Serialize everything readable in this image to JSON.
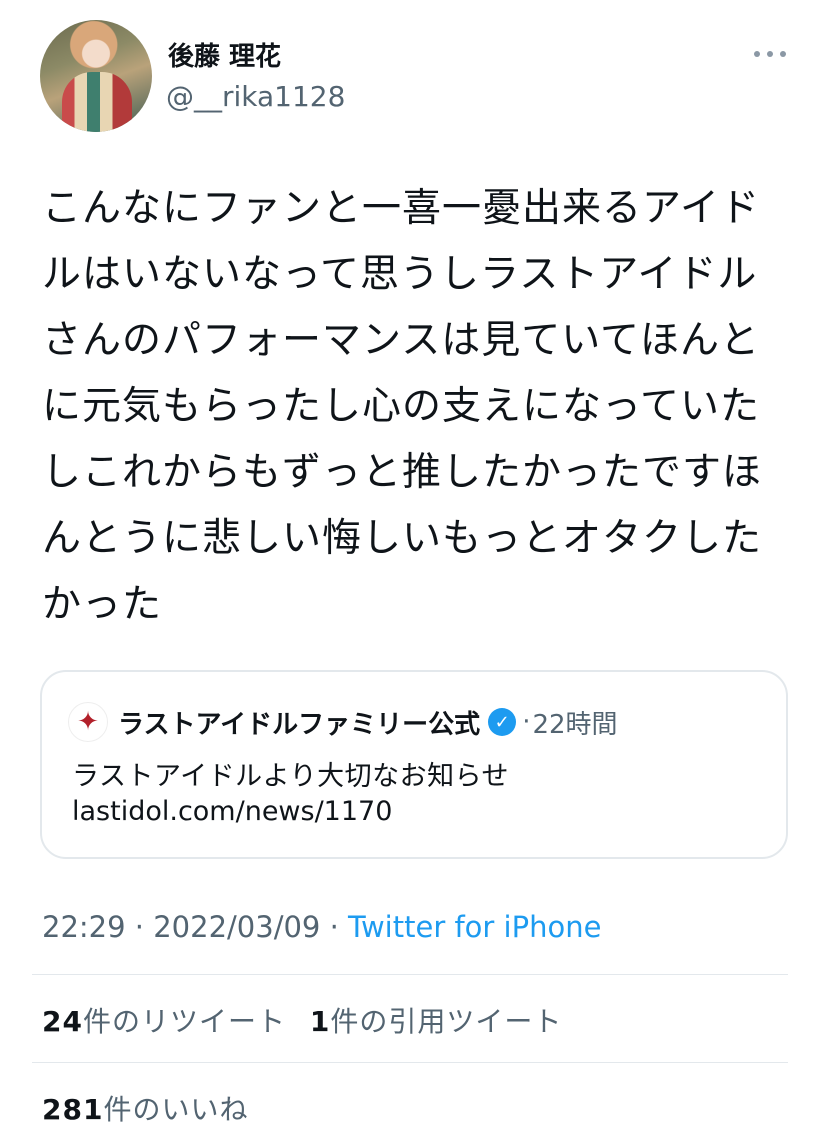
{
  "author": {
    "display_name": "後藤 理花",
    "handle": "@__rika1128",
    "avatar_icon": "profile-photo",
    "more_icon": "ellipsis-horizontal-icon"
  },
  "tweet": {
    "text": "こんなにファンと一喜一憂出来るアイドルはいないなって思うしラストアイドルさんのパフォーマンスは見ていてほんとに元気もらったし心の支えになっていたしこれからもずっと推したかったですほんとうに悲しい悔しいもっとオタクしたかった"
  },
  "quoted_tweet": {
    "account_name": "ラストアイドルファミリー公式",
    "verified_icon": "verified-badge-icon",
    "separator": "·",
    "time_ago": "22時間",
    "text": "ラストアイドルより大切なお知らせ",
    "link": "lastidol.com/news/1170"
  },
  "meta": {
    "time": "22:29",
    "sep1": " · ",
    "date": "2022/03/09",
    "sep2": " · ",
    "source": "Twitter for iPhone"
  },
  "stats": {
    "retweet_count": "24",
    "retweet_label": "件のリツイート",
    "quote_count": "1",
    "quote_label": "件の引用ツイート",
    "like_count": "281",
    "like_label": "件のいいね"
  },
  "colors": {
    "text": "#0f1419",
    "secondary": "#536471",
    "link": "#1d9bf0",
    "border": "#e3e8ec"
  }
}
